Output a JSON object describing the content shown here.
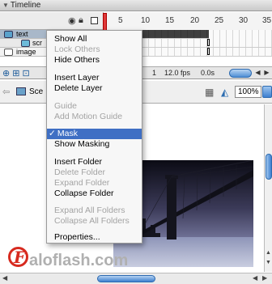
{
  "timeline": {
    "title": "Timeline",
    "ruler_numbers": [
      "5",
      "10",
      "15",
      "20",
      "25",
      "30",
      "35"
    ],
    "layers": [
      {
        "name": "text"
      },
      {
        "name": "scr"
      },
      {
        "name": "image"
      }
    ],
    "footer": {
      "frame": "1",
      "fps": "12.0 fps",
      "time": "0.0s"
    }
  },
  "editbar": {
    "scene_label": "Sce",
    "zoom": "100%"
  },
  "context_menu": {
    "items": [
      {
        "label": "Show All",
        "enabled": true
      },
      {
        "label": "Lock Others",
        "enabled": false
      },
      {
        "label": "Hide Others",
        "enabled": true
      },
      {
        "label": "Insert Layer",
        "enabled": true
      },
      {
        "label": "Delete Layer",
        "enabled": true
      },
      {
        "label": "Guide",
        "enabled": false
      },
      {
        "label": "Add Motion Guide",
        "enabled": false
      },
      {
        "label": "Mask",
        "enabled": true,
        "checked": true,
        "highlighted": true
      },
      {
        "label": "Show Masking",
        "enabled": true
      },
      {
        "label": "Insert Folder",
        "enabled": true
      },
      {
        "label": "Delete Folder",
        "enabled": false
      },
      {
        "label": "Expand Folder",
        "enabled": false
      },
      {
        "label": "Collapse Folder",
        "enabled": true
      },
      {
        "label": "Expand All Folders",
        "enabled": false
      },
      {
        "label": "Collapse All Folders",
        "enabled": false
      },
      {
        "label": "Properties...",
        "enabled": true
      }
    ],
    "check_mark": "✓"
  },
  "watermark": {
    "text": "aloflash.com",
    "logo_letter": "F"
  },
  "colors": {
    "menu_highlight": "#3f6fc4",
    "playhead": "#e03a3a",
    "selected_layer": "#a9b8c9",
    "logo_red": "#d72a1f"
  },
  "icons": [
    "eye-icon",
    "lock-icon",
    "outline-icon",
    "layer-icon",
    "mask-icon",
    "back-arrow-icon",
    "edit-symbol-icon",
    "edit-scene-icon"
  ]
}
